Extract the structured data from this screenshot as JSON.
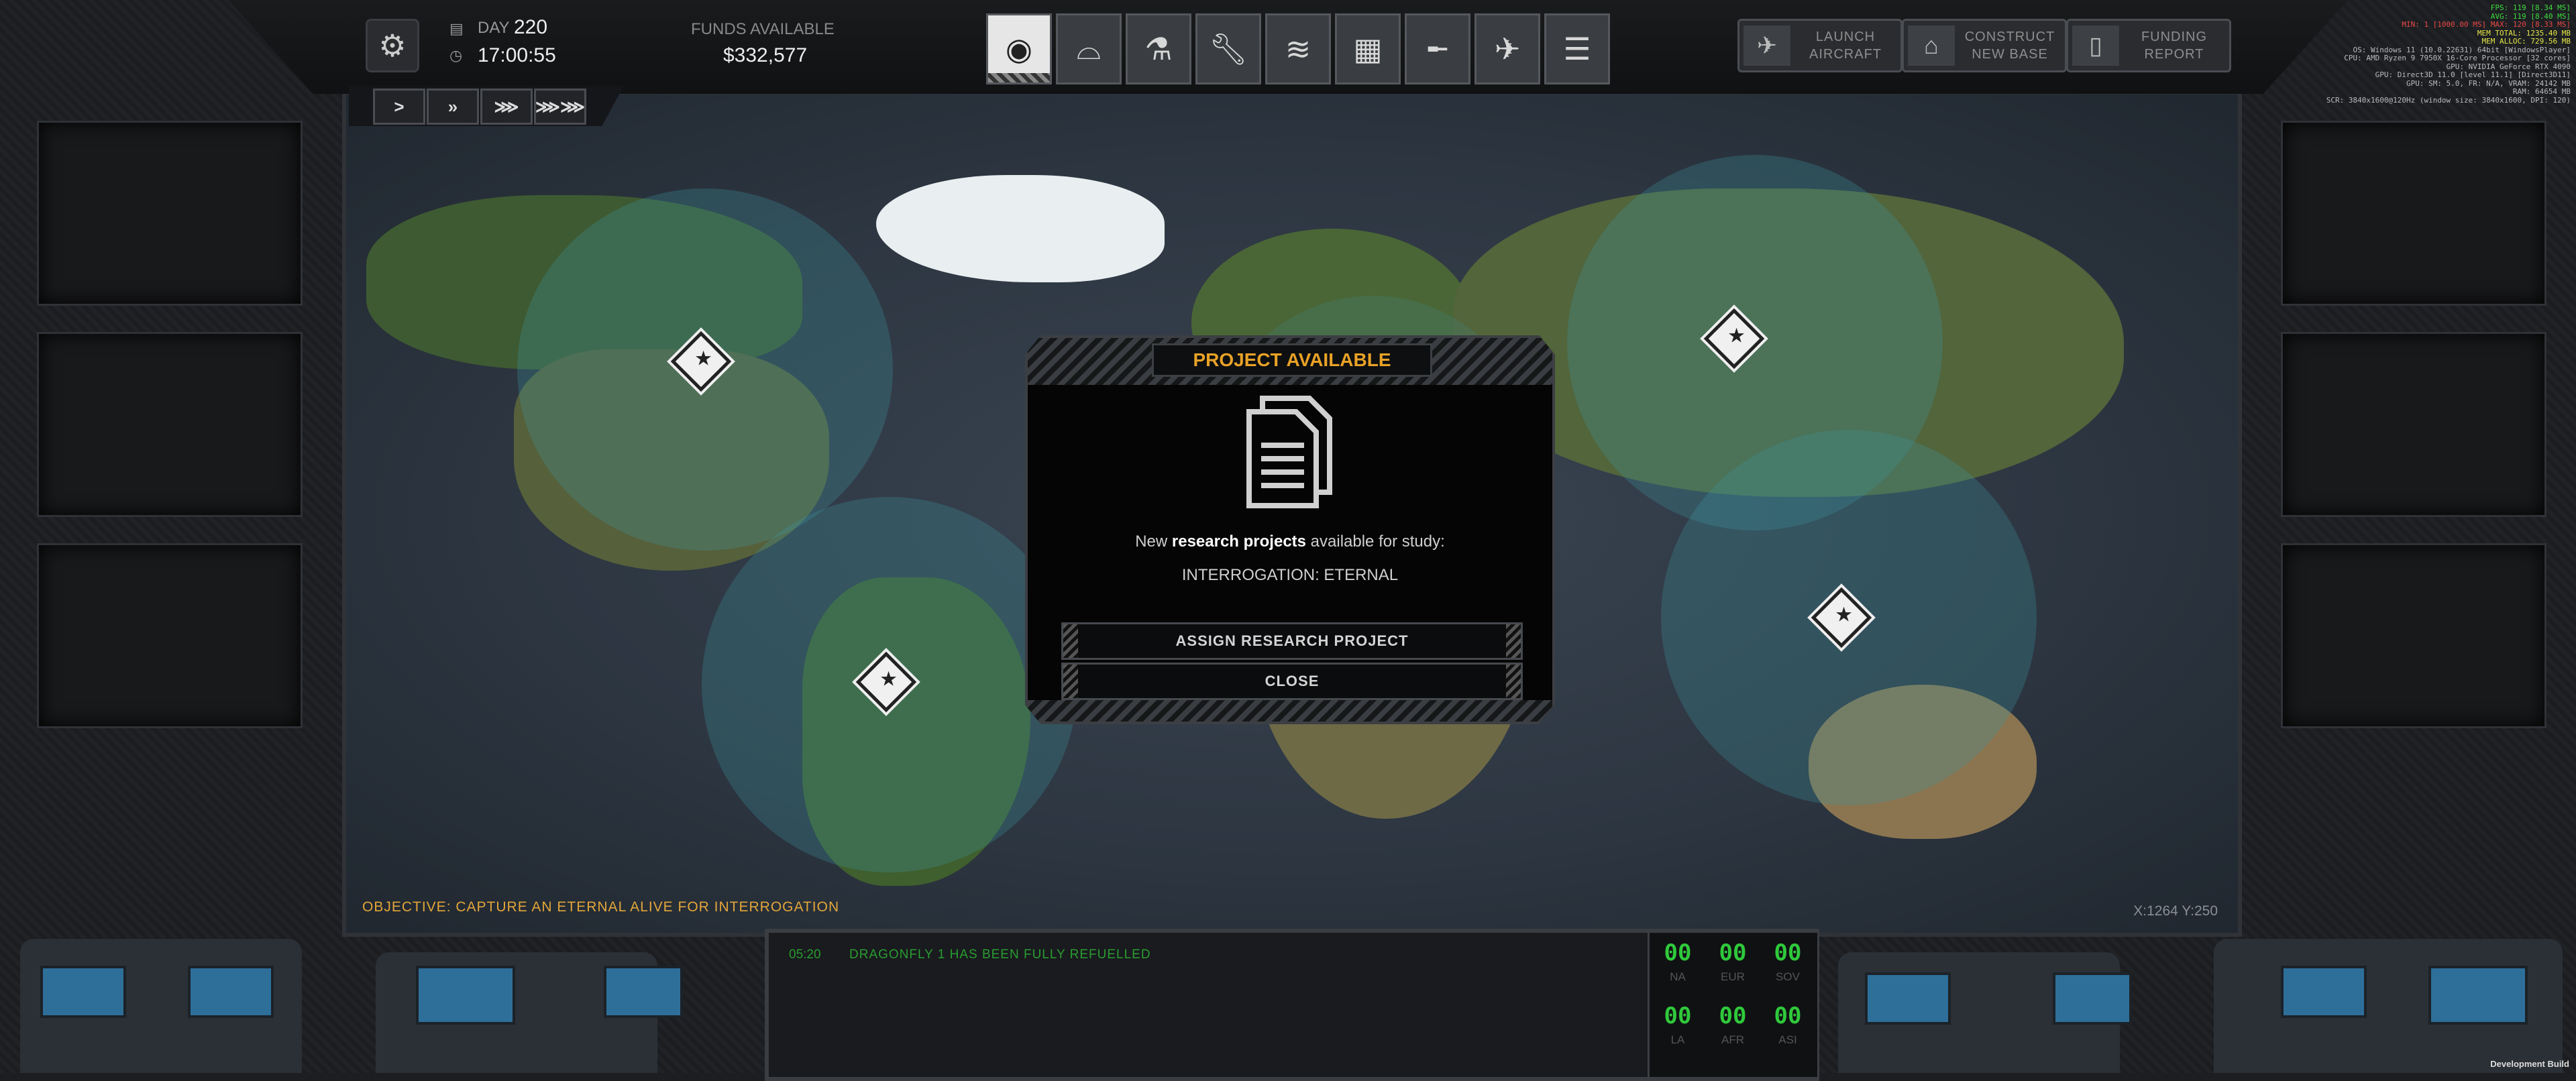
{
  "hud": {
    "day_label": "DAY",
    "day_value": "220",
    "time": "17:00:55",
    "funds_label": "FUNDS AVAILABLE",
    "funds_value": "$332,577"
  },
  "nav_icons": [
    "globe-icon",
    "hangar-icon",
    "research-icon",
    "engineering-icon",
    "soldiers-icon",
    "base-icon",
    "weapons-icon",
    "aircraft-icon",
    "archive-icon"
  ],
  "right_buttons": {
    "launch": [
      "LAUNCH",
      "AIRCRAFT"
    ],
    "construct": [
      "CONSTRUCT",
      "NEW BASE"
    ],
    "funding": [
      "FUNDING",
      "REPORT"
    ]
  },
  "speed": [
    ">",
    "»",
    "⋙",
    "⋙⋙"
  ],
  "dialog": {
    "title": "PROJECT AVAILABLE",
    "message_prefix": "New ",
    "message_bold": "research projects",
    "message_suffix": " available for study:",
    "project": "INTERROGATION: ETERNAL",
    "assign_button": "ASSIGN RESEARCH PROJECT",
    "close_button": "CLOSE"
  },
  "objective": "OBJECTIVE: CAPTURE AN ETERNAL ALIVE FOR INTERROGATION",
  "coords": "X:1264  Y:250",
  "log": {
    "time": "05:20",
    "message": "DRAGONFLY 1 HAS BEEN FULLY REFUELLED"
  },
  "regions": [
    {
      "value": "00",
      "label": "NA"
    },
    {
      "value": "00",
      "label": "EUR"
    },
    {
      "value": "00",
      "label": "SOV"
    },
    {
      "value": "00",
      "label": "LA"
    },
    {
      "value": "00",
      "label": "AFR"
    },
    {
      "value": "00",
      "label": "ASI"
    }
  ],
  "stats": [
    {
      "text": "FPS: 119 [8.34 MS]",
      "color": "#3fdc3f"
    },
    {
      "text": "AVG: 119 [8.40 MS]",
      "color": "#3fdc3f"
    },
    {
      "text": "MIN: 1 [1000.00 MS]  MAX: 120 [8.33 MS]",
      "color": "#e84848"
    },
    {
      "text": "MEM TOTAL: 1235.40 MB",
      "color": "#e8e84a"
    },
    {
      "text": "MEM ALLOC: 729.56 MB",
      "color": "#e8e84a"
    },
    {
      "text": "OS: Windows 11  (10.0.22631) 64bit [WindowsPlayer]",
      "color": "#bbbbbb"
    },
    {
      "text": "CPU: AMD Ryzen 9 7950X 16-Core Processor  [32 cores]",
      "color": "#bbbbbb"
    },
    {
      "text": "GPU: NVIDIA GeForce RTX 4090",
      "color": "#bbbbbb"
    },
    {
      "text": "GPU: Direct3D 11.0 [level 11.1] [Direct3D11]",
      "color": "#bbbbbb"
    },
    {
      "text": "GPU: SM: 5.0, FR: N/A, VRAM: 24142 MB",
      "color": "#bbbbbb"
    },
    {
      "text": "RAM: 64654 MB",
      "color": "#bbbbbb"
    },
    {
      "text": "SCR: 3840x1600@120Hz (window size: 3840x1600, DPI: 120)",
      "color": "#bbbbbb"
    }
  ],
  "build_label": "Development Build"
}
